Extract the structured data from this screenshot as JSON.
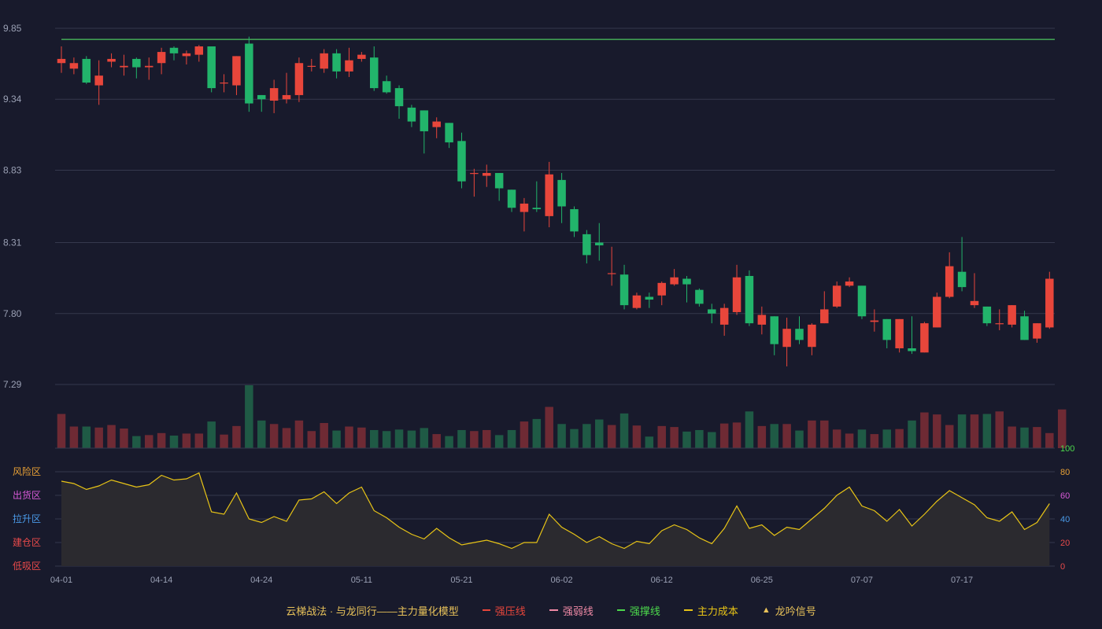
{
  "colors": {
    "background": "#181a2c",
    "up": "#e8463b",
    "down": "#22b46b",
    "up_volume": "#6e2a34",
    "down_volume": "#1f5a45",
    "grid": "#35384d",
    "strong_support_line": "#4cc75f",
    "score_line": "#e8c416",
    "score_fill": "#2b2a2f"
  },
  "chart_data": [
    {
      "type": "candlestick",
      "y_axis": {
        "ticks": [
          "9.85",
          "9.34",
          "8.83",
          "8.31",
          "7.80",
          "7.29"
        ],
        "range": [
          7.29,
          9.85
        ]
      },
      "x_axis": {
        "ticks": [
          "04-01",
          "04-14",
          "04-24",
          "05-11",
          "05-21",
          "06-02",
          "06-12",
          "06-25",
          "07-07",
          "07-17"
        ],
        "tick_bar_index": [
          0,
          8,
          16,
          24,
          32,
          40,
          48,
          56,
          64,
          72
        ]
      },
      "strong_support_level": 9.77,
      "ohlc": [
        [
          9.6,
          9.63,
          9.72,
          9.53
        ],
        [
          9.56,
          9.6,
          9.64,
          9.52
        ],
        [
          9.63,
          9.46,
          9.65,
          9.45
        ],
        [
          9.44,
          9.51,
          9.62,
          9.3
        ],
        [
          9.61,
          9.63,
          9.67,
          9.57
        ],
        [
          9.57,
          9.58,
          9.66,
          9.51
        ],
        [
          9.63,
          9.57,
          9.64,
          9.49
        ],
        [
          9.57,
          9.58,
          9.64,
          9.48
        ],
        [
          9.6,
          9.68,
          9.71,
          9.52
        ],
        [
          9.71,
          9.67,
          9.72,
          9.62
        ],
        [
          9.65,
          9.67,
          9.69,
          9.59
        ],
        [
          9.66,
          9.72,
          9.73,
          9.61
        ],
        [
          9.72,
          9.42,
          9.72,
          9.39
        ],
        [
          9.46,
          9.46,
          9.52,
          9.39
        ],
        [
          9.44,
          9.65,
          9.65,
          9.37
        ],
        [
          9.74,
          9.31,
          9.79,
          9.25
        ],
        [
          9.37,
          9.34,
          9.37,
          9.25
        ],
        [
          9.33,
          9.42,
          9.48,
          9.24
        ],
        [
          9.34,
          9.37,
          9.53,
          9.31
        ],
        [
          9.37,
          9.6,
          9.64,
          9.32
        ],
        [
          9.58,
          9.58,
          9.63,
          9.54
        ],
        [
          9.56,
          9.67,
          9.7,
          9.53
        ],
        [
          9.67,
          9.54,
          9.7,
          9.49
        ],
        [
          9.54,
          9.62,
          9.71,
          9.5
        ],
        [
          9.63,
          9.66,
          9.68,
          9.61
        ],
        [
          9.64,
          9.42,
          9.72,
          9.4
        ],
        [
          9.47,
          9.39,
          9.51,
          9.38
        ],
        [
          9.42,
          9.29,
          9.44,
          9.2
        ],
        [
          9.28,
          9.18,
          9.3,
          9.14
        ],
        [
          9.26,
          9.11,
          9.26,
          8.95
        ],
        [
          9.14,
          9.18,
          9.21,
          9.06
        ],
        [
          9.17,
          9.03,
          9.17,
          8.99
        ],
        [
          9.04,
          8.75,
          9.1,
          8.7
        ],
        [
          8.81,
          8.81,
          8.84,
          8.64
        ],
        [
          8.79,
          8.81,
          8.87,
          8.71
        ],
        [
          8.81,
          8.7,
          8.81,
          8.61
        ],
        [
          8.69,
          8.56,
          8.69,
          8.53
        ],
        [
          8.53,
          8.59,
          8.63,
          8.39
        ],
        [
          8.56,
          8.55,
          8.75,
          8.53
        ],
        [
          8.5,
          8.8,
          8.89,
          8.42
        ],
        [
          8.76,
          8.57,
          8.81,
          8.45
        ],
        [
          8.55,
          8.39,
          8.57,
          8.35
        ],
        [
          8.37,
          8.22,
          8.4,
          8.16
        ],
        [
          8.31,
          8.29,
          8.45,
          8.18
        ],
        [
          8.09,
          8.09,
          8.28,
          8.0
        ],
        [
          8.08,
          7.86,
          8.15,
          7.83
        ],
        [
          7.84,
          7.93,
          7.95,
          7.83
        ],
        [
          7.92,
          7.9,
          7.95,
          7.84
        ],
        [
          7.93,
          8.02,
          8.03,
          7.86
        ],
        [
          8.01,
          8.06,
          8.12,
          8.0
        ],
        [
          8.05,
          8.01,
          8.07,
          7.88
        ],
        [
          7.97,
          7.87,
          7.98,
          7.85
        ],
        [
          7.83,
          7.8,
          7.87,
          7.73
        ],
        [
          7.72,
          7.84,
          7.87,
          7.64
        ],
        [
          7.81,
          8.06,
          8.15,
          7.79
        ],
        [
          8.07,
          7.73,
          8.11,
          7.71
        ],
        [
          7.72,
          7.79,
          7.85,
          7.65
        ],
        [
          7.78,
          7.58,
          7.78,
          7.5
        ],
        [
          7.56,
          7.69,
          7.77,
          7.42
        ],
        [
          7.69,
          7.61,
          7.78,
          7.58
        ],
        [
          7.56,
          7.72,
          7.73,
          7.5
        ],
        [
          7.73,
          7.83,
          7.96,
          7.73
        ],
        [
          7.85,
          8.0,
          8.03,
          7.84
        ],
        [
          8.0,
          8.03,
          8.06,
          7.99
        ],
        [
          8.0,
          7.78,
          8.0,
          7.76
        ],
        [
          7.74,
          7.75,
          7.83,
          7.67
        ],
        [
          7.76,
          7.61,
          7.76,
          7.55
        ],
        [
          7.55,
          7.76,
          7.76,
          7.52
        ],
        [
          7.55,
          7.53,
          7.78,
          7.51
        ],
        [
          7.52,
          7.73,
          7.74,
          7.52
        ],
        [
          7.7,
          7.92,
          7.95,
          7.7
        ],
        [
          7.92,
          8.14,
          8.24,
          7.91
        ],
        [
          8.1,
          7.99,
          8.35,
          7.96
        ],
        [
          7.86,
          7.89,
          8.09,
          7.84
        ],
        [
          7.85,
          7.73,
          7.85,
          7.71
        ],
        [
          7.73,
          7.73,
          7.83,
          7.68
        ],
        [
          7.72,
          7.86,
          7.86,
          7.7
        ],
        [
          7.78,
          7.61,
          7.82,
          7.61
        ],
        [
          7.62,
          7.73,
          7.73,
          7.59
        ],
        [
          7.7,
          8.05,
          8.1,
          7.69
        ]
      ],
      "volume": [
        68,
        43,
        43,
        41,
        46,
        39,
        24,
        26,
        30,
        25,
        29,
        29,
        53,
        27,
        44,
        125,
        55,
        48,
        40,
        55,
        34,
        50,
        35,
        43,
        41,
        36,
        34,
        37,
        35,
        40,
        28,
        24,
        36,
        34,
        36,
        26,
        36,
        53,
        58,
        82,
        48,
        38,
        48,
        57,
        46,
        69,
        45,
        23,
        44,
        42,
        33,
        36,
        32,
        49,
        51,
        73,
        44,
        48,
        48,
        35,
        55,
        55,
        37,
        29,
        37,
        28,
        37,
        38,
        55,
        71,
        67,
        46,
        67,
        67,
        68,
        73,
        43,
        41,
        42,
        30,
        77
      ]
    },
    {
      "type": "area",
      "left_zone_labels": [
        {
          "label": "风险区",
          "color": "#e8a035"
        },
        {
          "label": "出货区",
          "color": "#d85ad8"
        },
        {
          "label": "拉升区",
          "color": "#4a9ae8"
        },
        {
          "label": "建仓区",
          "color": "#e84a4a"
        },
        {
          "label": "低吸区",
          "color": "#e84a4a"
        }
      ],
      "right_ticks": [
        {
          "label": "100",
          "color": "#4cd94c"
        },
        {
          "label": "80",
          "color": "#e8a035"
        },
        {
          "label": "60",
          "color": "#d85ad8"
        },
        {
          "label": "40",
          "color": "#4a9ae8"
        },
        {
          "label": "20",
          "color": "#e84a4a"
        },
        {
          "label": "0",
          "color": "#e84a4a"
        }
      ],
      "range": [
        0,
        100
      ],
      "values": [
        72,
        70,
        65,
        68,
        73,
        70,
        67,
        69,
        77,
        73,
        74,
        79,
        46,
        44,
        62,
        40,
        37,
        42,
        38,
        56,
        57,
        63,
        53,
        62,
        67,
        47,
        41,
        33,
        27,
        23,
        32,
        24,
        18,
        20,
        22,
        19,
        15,
        20,
        20,
        44,
        33,
        27,
        20,
        25,
        19,
        15,
        21,
        19,
        30,
        35,
        31,
        24,
        19,
        32,
        51,
        32,
        35,
        26,
        33,
        31,
        40,
        49,
        60,
        67,
        51,
        47,
        38,
        48,
        34,
        44,
        55,
        64,
        58,
        52,
        41,
        38,
        46,
        31,
        37,
        53
      ]
    }
  ],
  "legend": [
    {
      "label": "云梯战法 · 与龙同行——主力量化模型",
      "color": "#e8c25a",
      "marker": "none"
    },
    {
      "label": "强压线",
      "color": "#e8463b",
      "marker": "solid"
    },
    {
      "label": "强弱线",
      "color": "#f08aa6",
      "marker": "dashed"
    },
    {
      "label": "强撑线",
      "color": "#4cd94c",
      "marker": "solid"
    },
    {
      "label": "主力成本",
      "color": "#e8c416",
      "marker": "dashed"
    },
    {
      "label": "龙吟信号",
      "color": "#e8c25a",
      "marker": "triangle"
    }
  ]
}
